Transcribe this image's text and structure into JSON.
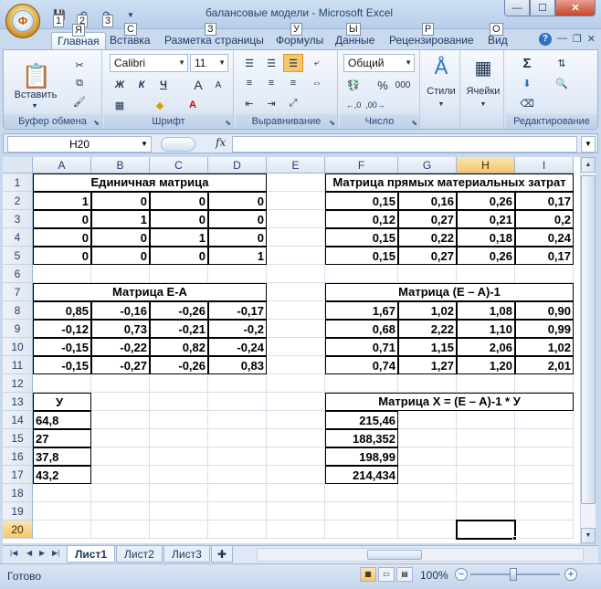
{
  "window": {
    "title": "балансовые модели - Microsoft Excel",
    "office_logo": "Ф",
    "qat_keytips": [
      "1",
      "2",
      "3"
    ],
    "controls": {
      "minimize": "—",
      "maximize": "☐",
      "close": "✕"
    }
  },
  "tabs": [
    {
      "label": "Главная",
      "keytip": "Я"
    },
    {
      "label": "Вставка",
      "keytip": "С"
    },
    {
      "label": "Разметка страницы",
      "keytip": "З"
    },
    {
      "label": "Формулы",
      "keytip": "У"
    },
    {
      "label": "Данные",
      "keytip": "Ы"
    },
    {
      "label": "Рецензирование",
      "keytip": "Р"
    },
    {
      "label": "Вид",
      "keytip": "О"
    }
  ],
  "ribbon": {
    "clipboard": {
      "label": "Буфер обмена",
      "paste": "Вставить"
    },
    "font": {
      "label": "Шрифт",
      "family": "Calibri",
      "size": "11",
      "bold": "Ж",
      "italic": "К",
      "underline": "Ч",
      "grow": "A",
      "shrink": "A"
    },
    "alignment": {
      "label": "Выравнивание"
    },
    "number": {
      "label": "Число",
      "format": "Общий",
      "percent": "%",
      "thousands": "000"
    },
    "styles": {
      "label": "Стили"
    },
    "cells": {
      "label": "Ячейки"
    },
    "editing": {
      "label": "Редактирование",
      "sum": "Σ"
    }
  },
  "formula_bar": {
    "name_box": "H20",
    "fx": "fx",
    "formula": ""
  },
  "columns": [
    "A",
    "B",
    "C",
    "D",
    "E",
    "F",
    "G",
    "H",
    "I"
  ],
  "selected_column": "H",
  "rows": [
    "1",
    "2",
    "3",
    "4",
    "5",
    "6",
    "7",
    "8",
    "9",
    "10",
    "11",
    "12",
    "13",
    "14",
    "15",
    "16",
    "17",
    "18",
    "19",
    "20"
  ],
  "selected_row": "20",
  "sheet": {
    "identity_title": "Единичная матрица",
    "direct_costs_title": "Матрица прямых материальных затрат",
    "e_minus_a_title": "Матрица E-A",
    "inverse_title": "Матрица (E – A)-1",
    "x_title": "Матрица X = (E – A)-1  * У",
    "y_header": "У",
    "identity": [
      [
        "1",
        "0",
        "0",
        "0"
      ],
      [
        "0",
        "1",
        "0",
        "0"
      ],
      [
        "0",
        "0",
        "1",
        "0"
      ],
      [
        "0",
        "0",
        "0",
        "1"
      ]
    ],
    "direct_costs": [
      [
        "0,15",
        "0,16",
        "0,26",
        "0,17"
      ],
      [
        "0,12",
        "0,27",
        "0,21",
        "0,2"
      ],
      [
        "0,15",
        "0,22",
        "0,18",
        "0,24"
      ],
      [
        "0,15",
        "0,27",
        "0,26",
        "0,17"
      ]
    ],
    "e_minus_a": [
      [
        "0,85",
        "-0,16",
        "-0,26",
        "-0,17"
      ],
      [
        "-0,12",
        "0,73",
        "-0,21",
        "-0,2"
      ],
      [
        "-0,15",
        "-0,22",
        "0,82",
        "-0,24"
      ],
      [
        "-0,15",
        "-0,27",
        "-0,26",
        "0,83"
      ]
    ],
    "inverse": [
      [
        "1,67",
        "1,02",
        "1,08",
        "0,90"
      ],
      [
        "0,68",
        "2,22",
        "1,10",
        "0,99"
      ],
      [
        "0,71",
        "1,15",
        "2,06",
        "1,02"
      ],
      [
        "0,74",
        "1,27",
        "1,20",
        "2,01"
      ]
    ],
    "y": [
      "64,8",
      "27",
      "37,8",
      "43,2"
    ],
    "x": [
      "215,46",
      "188,352",
      "198,99",
      "214,434"
    ]
  },
  "sheet_tabs": [
    "Лист1",
    "Лист2",
    "Лист3"
  ],
  "active_sheet": "Лист1",
  "status": {
    "text": "Готово",
    "zoom": "100%",
    "zoom_level_percent": 100
  }
}
